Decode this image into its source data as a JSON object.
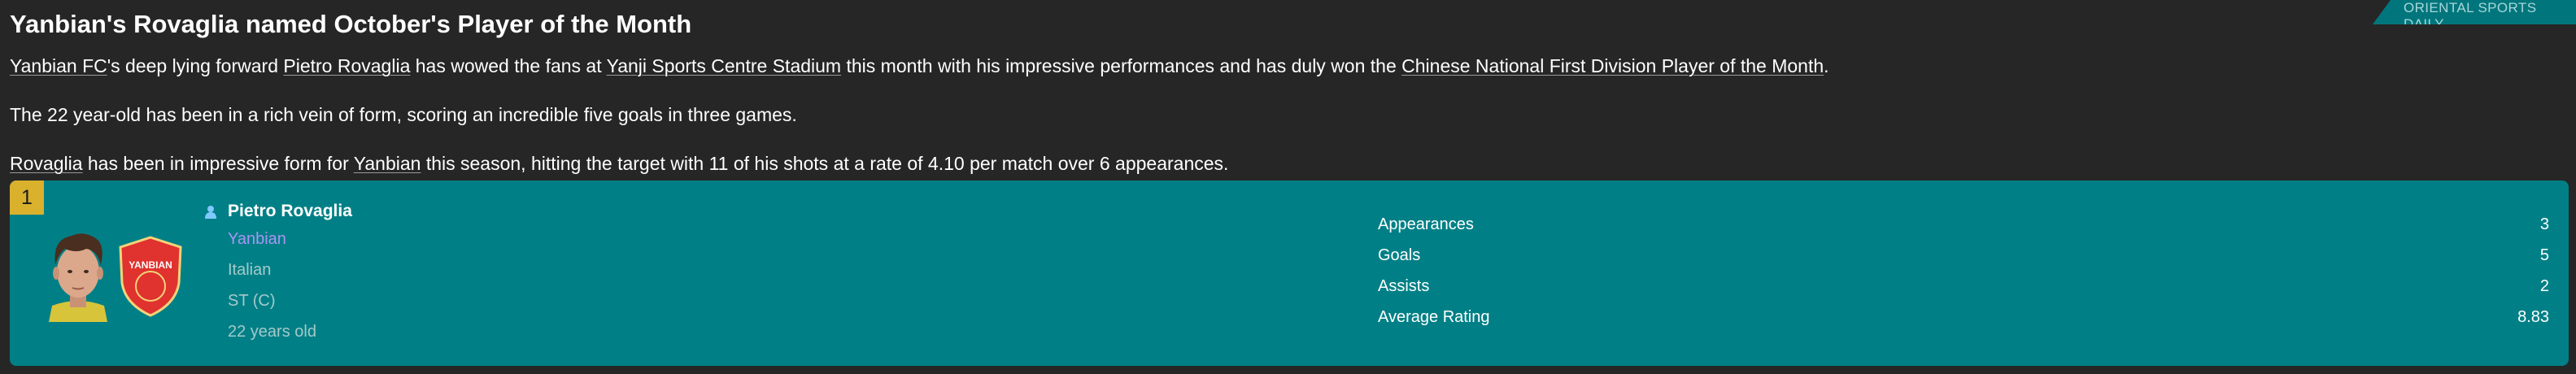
{
  "source_tag": "ORIENTAL SPORTS DAILY",
  "headline": "Yanbian's Rovaglia named October's Player of the Month",
  "paragraph1": {
    "club_link": "Yanbian FC",
    "text_a": "'s deep lying forward ",
    "player_link": "Pietro Rovaglia",
    "text_b": " has wowed the fans at ",
    "stadium_link": "Yanji Sports Centre Stadium",
    "text_c": " this month with his impressive performances and has duly won the ",
    "award_link": "Chinese National First Division Player of the Month",
    "text_d": "."
  },
  "paragraph2": "The 22 year-old has been in a rich vein of form, scoring an incredible five goals in three games.",
  "paragraph3": {
    "player_link": "Rovaglia",
    "text_a": " has been in impressive form for ",
    "club_link": "Yanbian",
    "text_b": " this season, hitting the target with 11 of his shots at a rate of 4.10 per match over 6 appearances."
  },
  "card": {
    "rank": "1",
    "player_name": "Pietro Rovaglia",
    "club": "Yanbian",
    "nationality": "Italian",
    "position": "ST (C)",
    "age": "22 years old",
    "crest_text": "YANBIAN",
    "stats": [
      {
        "label": "Appearances",
        "value": "3"
      },
      {
        "label": "Goals",
        "value": "5"
      },
      {
        "label": "Assists",
        "value": "2"
      },
      {
        "label": "Average Rating",
        "value": "8.83"
      }
    ]
  },
  "colors": {
    "background": "#262626",
    "card": "#008086",
    "rank_badge": "#d9b12d",
    "club_link": "#a796f5",
    "muted_text": "#a4c9cb"
  }
}
